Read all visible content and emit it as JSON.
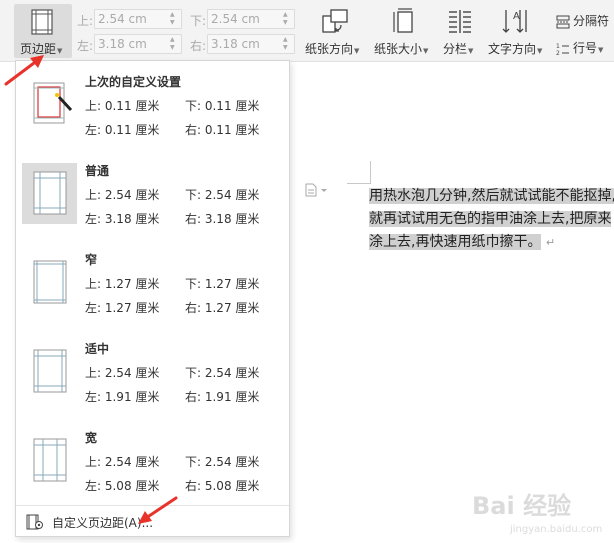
{
  "ribbon": {
    "margin_button": {
      "label": "页边距",
      "icon": "page-margins-icon"
    },
    "margin_fields": {
      "top": {
        "label": "上:",
        "value": "2.54 cm"
      },
      "bottom": {
        "label": "下:",
        "value": "2.54 cm"
      },
      "left": {
        "label": "左:",
        "value": "3.18 cm"
      },
      "right": {
        "label": "右:",
        "value": "3.18 cm"
      }
    },
    "orientation": {
      "label": "纸张方向",
      "icon": "paper-orientation-icon"
    },
    "paper_size": {
      "label": "纸张大小",
      "icon": "paper-size-icon"
    },
    "columns": {
      "label": "分栏",
      "icon": "columns-icon"
    },
    "text_direction": {
      "label": "文字方向",
      "icon": "text-direction-icon"
    },
    "separator": {
      "label": "分隔符",
      "icon": "separator-icon"
    },
    "line_number": {
      "label": "行号",
      "icon": "line-number-icon"
    }
  },
  "dropdown": {
    "presets": [
      {
        "name": "上次的自定义设置",
        "top": "上: 0.11 厘米",
        "bottom": "下: 0.11 厘米",
        "left": "左: 0.11 厘米",
        "right": "右: 0.11 厘米",
        "selected": false
      },
      {
        "name": "普通",
        "top": "上: 2.54 厘米",
        "bottom": "下: 2.54 厘米",
        "left": "左: 3.18 厘米",
        "right": "右: 3.18 厘米",
        "selected": true
      },
      {
        "name": "窄",
        "top": "上: 1.27 厘米",
        "bottom": "下: 1.27 厘米",
        "left": "左: 1.27 厘米",
        "right": "右: 1.27 厘米",
        "selected": false
      },
      {
        "name": "适中",
        "top": "上: 2.54 厘米",
        "bottom": "下: 2.54 厘米",
        "left": "左: 1.91 厘米",
        "right": "右: 1.91 厘米",
        "selected": false
      },
      {
        "name": "宽",
        "top": "上: 2.54 厘米",
        "bottom": "下: 2.54 厘米",
        "left": "左: 5.08 厘米",
        "right": "右: 5.08 厘米",
        "selected": false
      }
    ],
    "custom_label": "自定义页边距(A)..."
  },
  "document": {
    "lines": [
      "用热水泡几分钟,然后就试试能不能抠掉,",
      "就再试试用无色的指甲油涂上去,把原来",
      "涂上去,再快速用纸巾擦干。"
    ],
    "paragraph_mark": "↵"
  },
  "watermark": {
    "text": "Bai 经验",
    "subtext": "jingyan.baidu.com"
  },
  "colors": {
    "ribbon_bg": "#f3f3f3",
    "selected_bg": "#dcdcdc",
    "highlight": "#d0d0d0",
    "arrow": "#e8322a"
  }
}
